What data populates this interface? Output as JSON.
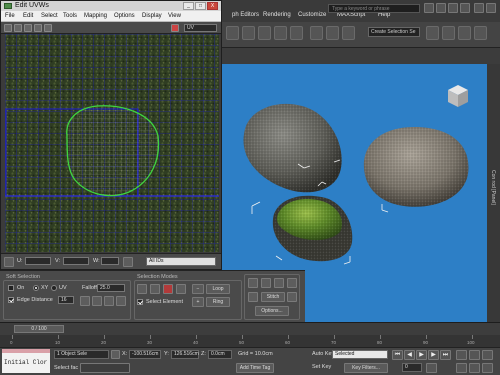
{
  "max_menu": {
    "items": [
      "ph Editors",
      "Rendering",
      "Customize",
      "MAXScript",
      "Help"
    ],
    "search_placeholder": "Type a keyword or phrase"
  },
  "max_toolbar": {
    "selection_set_placeholder": "Create Selection Se"
  },
  "viewport": {
    "side_label": "Con rod [Panel]"
  },
  "uvw_window": {
    "title": "Edit UVWs",
    "menus": [
      "File",
      "Edit",
      "Select",
      "Tools",
      "Mapping",
      "Options",
      "Display",
      "View"
    ],
    "uv_dropdown": "UV",
    "controls": [
      "_",
      "□",
      "X"
    ],
    "status": {
      "u_label": "U:",
      "v_label": "V:",
      "w_label": "W:",
      "ids_dropdown": "All IDs"
    }
  },
  "soft_selection": {
    "title": "Soft Selection",
    "on_label": "On",
    "xy_label": "XY",
    "uv_label": "UV",
    "falloff_label": "Falloff:",
    "falloff_value": "25.0",
    "edge_distance_label": "Edge Distance",
    "edge_distance_value": "16",
    "edge_distance_checked": true
  },
  "selection_modes": {
    "title": "Selection Modes",
    "select_element_label": "Select Element",
    "loop_label": "Loop",
    "ring_label": "Ring",
    "stitch_label": "Stitch",
    "options_label": "Options..."
  },
  "timeline": {
    "slider_label": "0 / 100",
    "ticks": [
      "0",
      "10",
      "20",
      "30",
      "40",
      "50",
      "60",
      "70",
      "80",
      "90",
      "100"
    ]
  },
  "status": {
    "maxscript_listener": "Initial Clor",
    "selected_text": "1 Object Sele",
    "x_label": "X:",
    "x_value": "-100.516cm",
    "y_label": "Y:",
    "y_value": "126.516cm",
    "z_label": "Z:",
    "z_value": "0.0cm",
    "grid_text": "Grid = 10.0cm",
    "auto_key": "Auto Key",
    "selected_dropdown": "Selected",
    "set_key": "Set Key",
    "key_filters": "Key Filters...",
    "prompt": "Select fac",
    "add_time_tag": "Add Time Tag",
    "frame_value": "0"
  },
  "colors": {
    "viewport_bg": "#2d7fc6",
    "uv_shell_outline": "#3fd53f",
    "uv_grid": "#1d1dd8"
  }
}
